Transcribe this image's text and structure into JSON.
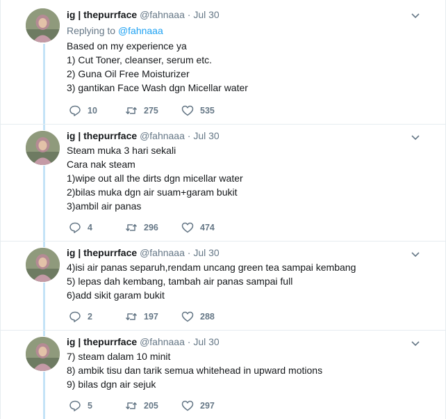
{
  "tweets": [
    {
      "name": "ig | thepurrface",
      "handle": "@fahnaaa",
      "time": "Jul 30",
      "replying_prefix": "Replying to",
      "replying_to": "@fahnaaa",
      "lines": [
        "Based on my experience ya",
        "1) Cut Toner, cleanser, serum etc.",
        "2) Guna Oil Free Moisturizer",
        "3) gantikan Face Wash dgn Micellar water"
      ],
      "replies": "10",
      "retweets": "275",
      "likes": "535"
    },
    {
      "name": "ig | thepurrface",
      "handle": "@fahnaaa",
      "time": "Jul 30",
      "lines": [
        "Steam muka 3 hari sekali",
        "Cara nak steam",
        "1)wipe out all the dirts dgn micellar water",
        "2)bilas muka dgn air suam+garam bukit",
        "3)ambil air panas"
      ],
      "replies": "4",
      "retweets": "296",
      "likes": "474"
    },
    {
      "name": "ig | thepurrface",
      "handle": "@fahnaaa",
      "time": "Jul 30",
      "lines": [
        "4)isi air panas separuh,rendam uncang green tea sampai kembang",
        "5) lepas dah kembang, tambah air panas sampai full",
        "6)add sikit garam bukit"
      ],
      "replies": "2",
      "retweets": "197",
      "likes": "288"
    },
    {
      "name": "ig | thepurrface",
      "handle": "@fahnaaa",
      "time": "Jul 30",
      "lines": [
        "7) steam dalam 10 minit",
        "8) ambik tisu dan tarik semua whitehead in upward motions",
        "9) bilas dgn air sejuk"
      ],
      "replies": "5",
      "retweets": "205",
      "likes": "297"
    }
  ],
  "separator": "·",
  "icons": {
    "reply": "reply-icon",
    "retweet": "retweet-icon",
    "like": "heart-icon",
    "caret": "chevron-down-icon"
  },
  "colors": {
    "link": "#1da1f2",
    "secondary_text": "#657786",
    "thread_line": "#c4e3f7",
    "divider": "#e6ecf0"
  }
}
